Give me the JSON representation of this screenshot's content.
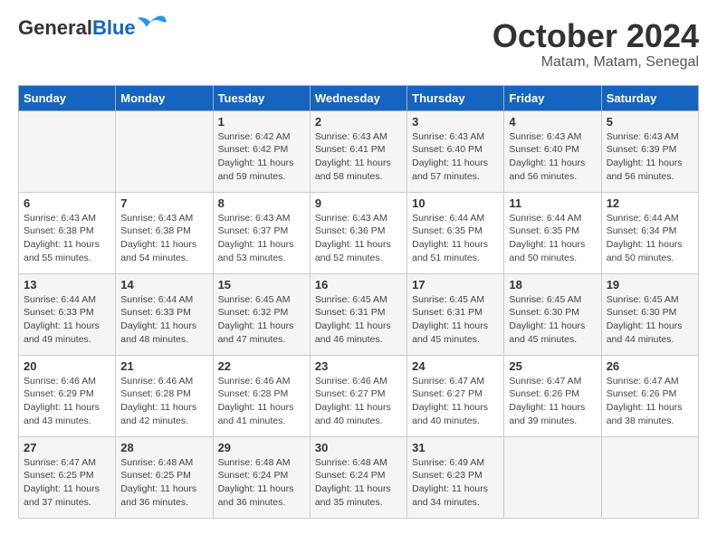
{
  "header": {
    "logo_general": "General",
    "logo_blue": "Blue",
    "title": "October 2024",
    "location": "Matam, Matam, Senegal"
  },
  "weekdays": [
    "Sunday",
    "Monday",
    "Tuesday",
    "Wednesday",
    "Thursday",
    "Friday",
    "Saturday"
  ],
  "weeks": [
    [
      {
        "num": "",
        "detail": ""
      },
      {
        "num": "",
        "detail": ""
      },
      {
        "num": "1",
        "detail": "Sunrise: 6:42 AM\nSunset: 6:42 PM\nDaylight: 11 hours and 59 minutes."
      },
      {
        "num": "2",
        "detail": "Sunrise: 6:43 AM\nSunset: 6:41 PM\nDaylight: 11 hours and 58 minutes."
      },
      {
        "num": "3",
        "detail": "Sunrise: 6:43 AM\nSunset: 6:40 PM\nDaylight: 11 hours and 57 minutes."
      },
      {
        "num": "4",
        "detail": "Sunrise: 6:43 AM\nSunset: 6:40 PM\nDaylight: 11 hours and 56 minutes."
      },
      {
        "num": "5",
        "detail": "Sunrise: 6:43 AM\nSunset: 6:39 PM\nDaylight: 11 hours and 56 minutes."
      }
    ],
    [
      {
        "num": "6",
        "detail": "Sunrise: 6:43 AM\nSunset: 6:38 PM\nDaylight: 11 hours and 55 minutes."
      },
      {
        "num": "7",
        "detail": "Sunrise: 6:43 AM\nSunset: 6:38 PM\nDaylight: 11 hours and 54 minutes."
      },
      {
        "num": "8",
        "detail": "Sunrise: 6:43 AM\nSunset: 6:37 PM\nDaylight: 11 hours and 53 minutes."
      },
      {
        "num": "9",
        "detail": "Sunrise: 6:43 AM\nSunset: 6:36 PM\nDaylight: 11 hours and 52 minutes."
      },
      {
        "num": "10",
        "detail": "Sunrise: 6:44 AM\nSunset: 6:35 PM\nDaylight: 11 hours and 51 minutes."
      },
      {
        "num": "11",
        "detail": "Sunrise: 6:44 AM\nSunset: 6:35 PM\nDaylight: 11 hours and 50 minutes."
      },
      {
        "num": "12",
        "detail": "Sunrise: 6:44 AM\nSunset: 6:34 PM\nDaylight: 11 hours and 50 minutes."
      }
    ],
    [
      {
        "num": "13",
        "detail": "Sunrise: 6:44 AM\nSunset: 6:33 PM\nDaylight: 11 hours and 49 minutes."
      },
      {
        "num": "14",
        "detail": "Sunrise: 6:44 AM\nSunset: 6:33 PM\nDaylight: 11 hours and 48 minutes."
      },
      {
        "num": "15",
        "detail": "Sunrise: 6:45 AM\nSunset: 6:32 PM\nDaylight: 11 hours and 47 minutes."
      },
      {
        "num": "16",
        "detail": "Sunrise: 6:45 AM\nSunset: 6:31 PM\nDaylight: 11 hours and 46 minutes."
      },
      {
        "num": "17",
        "detail": "Sunrise: 6:45 AM\nSunset: 6:31 PM\nDaylight: 11 hours and 45 minutes."
      },
      {
        "num": "18",
        "detail": "Sunrise: 6:45 AM\nSunset: 6:30 PM\nDaylight: 11 hours and 45 minutes."
      },
      {
        "num": "19",
        "detail": "Sunrise: 6:45 AM\nSunset: 6:30 PM\nDaylight: 11 hours and 44 minutes."
      }
    ],
    [
      {
        "num": "20",
        "detail": "Sunrise: 6:46 AM\nSunset: 6:29 PM\nDaylight: 11 hours and 43 minutes."
      },
      {
        "num": "21",
        "detail": "Sunrise: 6:46 AM\nSunset: 6:28 PM\nDaylight: 11 hours and 42 minutes."
      },
      {
        "num": "22",
        "detail": "Sunrise: 6:46 AM\nSunset: 6:28 PM\nDaylight: 11 hours and 41 minutes."
      },
      {
        "num": "23",
        "detail": "Sunrise: 6:46 AM\nSunset: 6:27 PM\nDaylight: 11 hours and 40 minutes."
      },
      {
        "num": "24",
        "detail": "Sunrise: 6:47 AM\nSunset: 6:27 PM\nDaylight: 11 hours and 40 minutes."
      },
      {
        "num": "25",
        "detail": "Sunrise: 6:47 AM\nSunset: 6:26 PM\nDaylight: 11 hours and 39 minutes."
      },
      {
        "num": "26",
        "detail": "Sunrise: 6:47 AM\nSunset: 6:26 PM\nDaylight: 11 hours and 38 minutes."
      }
    ],
    [
      {
        "num": "27",
        "detail": "Sunrise: 6:47 AM\nSunset: 6:25 PM\nDaylight: 11 hours and 37 minutes."
      },
      {
        "num": "28",
        "detail": "Sunrise: 6:48 AM\nSunset: 6:25 PM\nDaylight: 11 hours and 36 minutes."
      },
      {
        "num": "29",
        "detail": "Sunrise: 6:48 AM\nSunset: 6:24 PM\nDaylight: 11 hours and 36 minutes."
      },
      {
        "num": "30",
        "detail": "Sunrise: 6:48 AM\nSunset: 6:24 PM\nDaylight: 11 hours and 35 minutes."
      },
      {
        "num": "31",
        "detail": "Sunrise: 6:49 AM\nSunset: 6:23 PM\nDaylight: 11 hours and 34 minutes."
      },
      {
        "num": "",
        "detail": ""
      },
      {
        "num": "",
        "detail": ""
      }
    ]
  ]
}
